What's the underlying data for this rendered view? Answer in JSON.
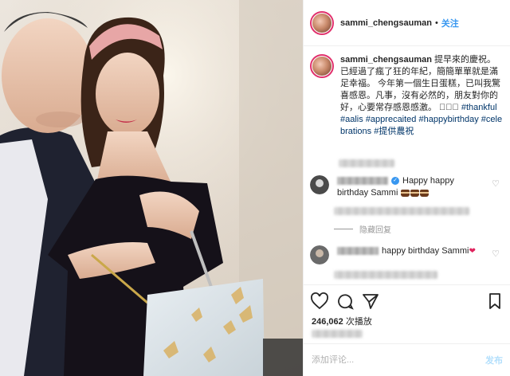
{
  "post": {
    "username": "sammi_chengsauman",
    "dot": "•",
    "follow_label": "关注"
  },
  "caption": {
    "username": "sammi_chengsauman",
    "text": "提早來的慶祝。已經過了瘋了狂的年紀，簡簡單單就是滿足幸福。 今年第一個生日蛋糕，已叫我驚喜感恩。凡事，沒有必然的，朋友對你的好，心要常存感恩感激。",
    "emoji": "🏻🏻🏻",
    "hashtags": [
      "#thankful",
      "#aalis",
      "#apprecaited",
      "#happybirthday",
      "#celebrations",
      "#提供農祝"
    ]
  },
  "comments": [
    {
      "text": "Happy happy birthday Sammi",
      "emoji": "cake"
    },
    {
      "text": "happy birthday Sammi",
      "emoji": "heart"
    }
  ],
  "hide_replies_label": "隐藏回复",
  "stats": {
    "views_count": "246,062",
    "views_label": "次播放"
  },
  "comment_input": {
    "placeholder": "添加评论...",
    "post_label": "发布"
  },
  "colors": {
    "link": "#3897f0",
    "hashtag": "#003569",
    "text": "#262626"
  }
}
